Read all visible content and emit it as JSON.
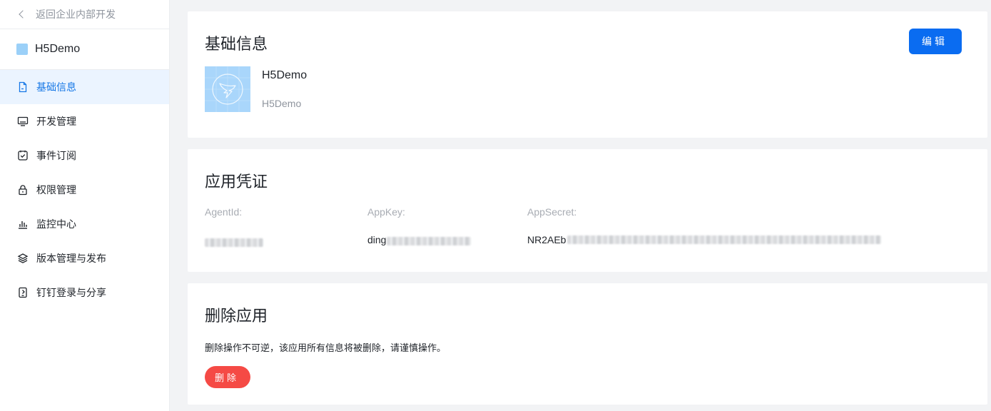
{
  "sidebar": {
    "back_label": "返回企业内部开发",
    "app_name": "H5Demo",
    "app_square_color": "#9bd0f8",
    "items": [
      {
        "label": "基础信息",
        "icon": "document-icon",
        "active": true
      },
      {
        "label": "开发管理",
        "icon": "monitor-icon",
        "active": false
      },
      {
        "label": "事件订阅",
        "icon": "subscribe-icon",
        "active": false
      },
      {
        "label": "权限管理",
        "icon": "lock-icon",
        "active": false
      },
      {
        "label": "监控中心",
        "icon": "bar-chart-icon",
        "active": false
      },
      {
        "label": "版本管理与发布",
        "icon": "layers-icon",
        "active": false
      },
      {
        "label": "钉钉登录与分享",
        "icon": "phone-share-icon",
        "active": false
      }
    ]
  },
  "basic_info": {
    "title": "基础信息",
    "edit_label": "编辑",
    "app_name": "H5Demo",
    "app_desc": "H5Demo",
    "logo_icon": "dingtalk-logo-icon"
  },
  "credentials": {
    "title": "应用凭证",
    "agent_id": {
      "label": "AgentId:",
      "value": ""
    },
    "app_key": {
      "label": "AppKey:",
      "value": "ding"
    },
    "app_secret": {
      "label": "AppSecret:",
      "value": "NR2AEb"
    }
  },
  "delete_app": {
    "title": "删除应用",
    "description": "删除操作不可逆，该应用所有信息将被删除，请谨慎操作。",
    "delete_label": "删除"
  },
  "colors": {
    "primary": "#0a6cf1",
    "danger": "#f54a45",
    "active_bg": "#ebf4ff",
    "active_text": "#1677e6"
  }
}
